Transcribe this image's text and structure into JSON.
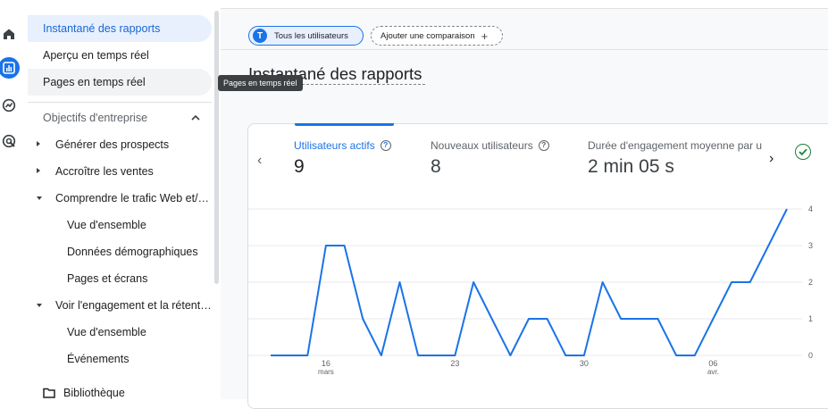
{
  "rail": {
    "icons": [
      "home-icon",
      "reports-icon",
      "explore-icon",
      "advertising-icon"
    ],
    "active_index": 1
  },
  "nav": {
    "items": [
      {
        "label": "Instantané des rapports",
        "level": 1,
        "state": "active"
      },
      {
        "label": "Aperçu en temps réel",
        "level": 1
      },
      {
        "label": "Pages en temps réel",
        "level": 1,
        "state": "hover"
      },
      {
        "label": "Objectifs d'entreprise",
        "level": 1,
        "section": true
      },
      {
        "label": "Générer des prospects",
        "level": 2,
        "toggle": "collapsed"
      },
      {
        "label": "Accroître les ventes",
        "level": 2,
        "toggle": "collapsed"
      },
      {
        "label": "Comprendre le trafic Web et/…",
        "level": 2,
        "toggle": "expanded"
      },
      {
        "label": "Vue d'ensemble",
        "level": 3
      },
      {
        "label": "Données démographiques",
        "level": 3
      },
      {
        "label": "Pages et écrans",
        "level": 3
      },
      {
        "label": "Voir l'engagement et la rétent…",
        "level": 2,
        "toggle": "expanded"
      },
      {
        "label": "Vue d'ensemble",
        "level": 3
      },
      {
        "label": "Événements",
        "level": 3
      },
      {
        "label": "Bibliothèque",
        "level": 1,
        "icon": "folder-icon"
      }
    ]
  },
  "tooltip": "Pages en temps réel",
  "chips": {
    "all_users": {
      "badge": "T",
      "label": "Tous les utilisateurs"
    },
    "add_comparison": {
      "label": "Ajouter une comparaison",
      "icon": "plus-icon"
    }
  },
  "page": {
    "title": "Instantané des rapports"
  },
  "metrics": [
    {
      "label": "Utilisateurs actifs",
      "value": "9",
      "active": true,
      "help_icon": true
    },
    {
      "label": "Nouveaux utilisateurs",
      "value": "8",
      "help_icon": true
    },
    {
      "label": "Durée d'engagement moyenne par u",
      "value": "2 min 05 s"
    }
  ],
  "colors": {
    "accent": "#1a73e8",
    "status_ok": "#188038",
    "line": "#1a73e8"
  },
  "chart_data": {
    "type": "line",
    "x": [
      0,
      1,
      2,
      3,
      4,
      5,
      6,
      7,
      8,
      9,
      10,
      11,
      12,
      13,
      14,
      15,
      16,
      17,
      18,
      19,
      20,
      21,
      22,
      23,
      24,
      25,
      26,
      27,
      28
    ],
    "x_tick_labels": [
      {
        "index": 3,
        "day": "16",
        "month": "mars"
      },
      {
        "index": 10,
        "day": "23",
        "month": ""
      },
      {
        "index": 17,
        "day": "30",
        "month": ""
      },
      {
        "index": 24,
        "day": "06",
        "month": "avr."
      }
    ],
    "series": [
      {
        "values": [
          0,
          0,
          0,
          3,
          3,
          1,
          0,
          2,
          0,
          0,
          0,
          2,
          1,
          0,
          1,
          1,
          0,
          0,
          2,
          1,
          1,
          1,
          0,
          0,
          1,
          2,
          2,
          3,
          4
        ]
      }
    ],
    "ylim": [
      0,
      4
    ],
    "y_ticks": [
      "0",
      "1",
      "2",
      "3",
      "4"
    ],
    "y_axis_side": "right",
    "grid": true
  }
}
